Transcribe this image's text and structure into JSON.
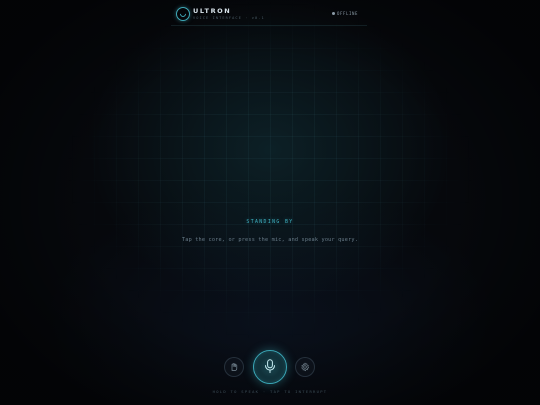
{
  "header": {
    "brand": "ULTRON",
    "subtitle": "VOICE INTERFACE · v0.1",
    "status": "OFFLINE",
    "status_color": "#8a9aa6"
  },
  "main": {
    "status": "STANDING BY",
    "hint": "Tap the core, or press the mic, and speak your query."
  },
  "controls": {
    "left_icon": "hand-icon",
    "center_icon": "microphone-icon",
    "right_icon": "gear-icon"
  },
  "footer": {
    "hint": "HOLD TO SPEAK · TAP TO INTERRUPT"
  },
  "colors": {
    "accent": "#3fb4c4",
    "background": "#06080c"
  }
}
